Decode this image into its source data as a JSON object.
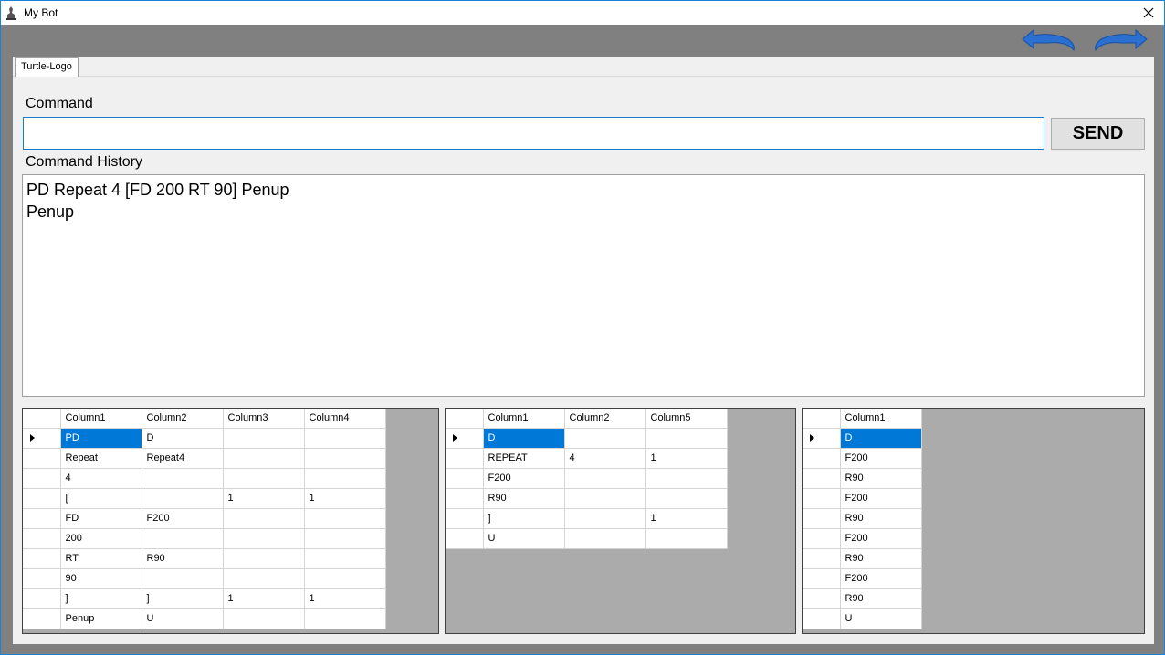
{
  "window": {
    "title": "My Bot"
  },
  "tab": {
    "label": "Turtle-Logo"
  },
  "command": {
    "label": "Command",
    "value": "",
    "send_label": "SEND"
  },
  "history": {
    "label": "Command History",
    "lines": [
      "PD Repeat 4 [FD 200 RT 90] Penup",
      "Penup"
    ]
  },
  "grid1": {
    "columns": [
      "Column1",
      "Column2",
      "Column3",
      "Column4"
    ],
    "rows": [
      [
        "PD",
        "D",
        "",
        ""
      ],
      [
        "Repeat",
        "Repeat4",
        "",
        ""
      ],
      [
        "4",
        "",
        "",
        ""
      ],
      [
        "[",
        "",
        "1",
        "1"
      ],
      [
        "FD",
        "F200",
        "",
        ""
      ],
      [
        "200",
        "",
        "",
        ""
      ],
      [
        "RT",
        "R90",
        "",
        ""
      ],
      [
        "90",
        "",
        "",
        ""
      ],
      [
        "]",
        "]",
        "1",
        "1"
      ],
      [
        "Penup",
        "U",
        "",
        ""
      ]
    ]
  },
  "grid2": {
    "columns": [
      "Column1",
      "Column2",
      "Column5"
    ],
    "rows": [
      [
        "D",
        "",
        ""
      ],
      [
        "REPEAT",
        "4",
        "1"
      ],
      [
        "F200",
        "",
        ""
      ],
      [
        "R90",
        "",
        ""
      ],
      [
        "]",
        "",
        "1"
      ],
      [
        "U",
        "",
        ""
      ]
    ]
  },
  "grid3": {
    "columns": [
      "Column1"
    ],
    "rows": [
      [
        "D"
      ],
      [
        "F200"
      ],
      [
        "R90"
      ],
      [
        "F200"
      ],
      [
        "R90"
      ],
      [
        "F200"
      ],
      [
        "R90"
      ],
      [
        "F200"
      ],
      [
        "R90"
      ],
      [
        "U"
      ]
    ]
  },
  "colors": {
    "selection": "#0078d7",
    "accent_border": "#1979ca",
    "nav_arrow": "#2b6fd1"
  }
}
